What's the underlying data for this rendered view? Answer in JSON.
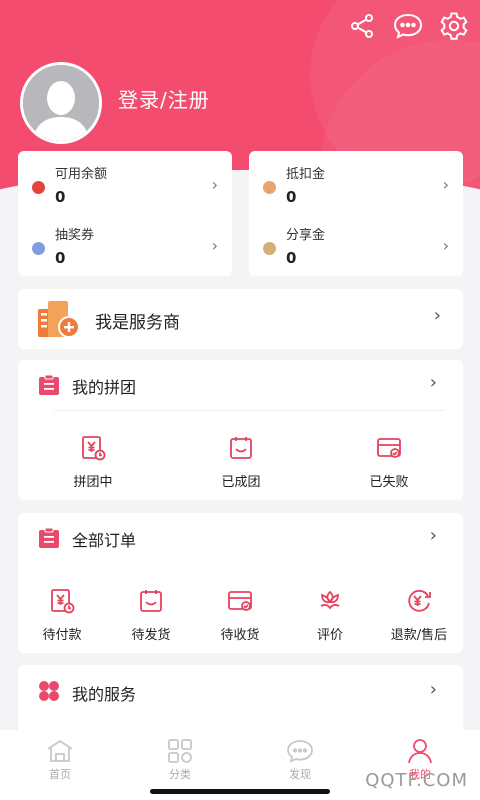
{
  "header": {
    "login_text": "登录/注册",
    "share_icon": "share-icon",
    "message_icon": "chat-bubble-icon",
    "settings_icon": "gear-icon",
    "brand_color": "#f34c6f"
  },
  "wallet": {
    "left": [
      {
        "label": "可用余额",
        "value": "0",
        "dot_color": "#e5443e"
      },
      {
        "label": "抽奖券",
        "value": "0",
        "dot_color": "#7f9de0"
      }
    ],
    "right": [
      {
        "label": "抵扣金",
        "value": "0",
        "dot_color": "#e8a46c"
      },
      {
        "label": "分享金",
        "value": "0",
        "dot_color": "#d3b07a"
      }
    ]
  },
  "provider": {
    "label": "我是服务商"
  },
  "group": {
    "title": "我的拼团",
    "items": [
      {
        "label": "拼团中",
        "icon": "yen-clock-icon"
      },
      {
        "label": "已成团",
        "icon": "clipboard-smile-icon"
      },
      {
        "label": "已失败",
        "icon": "box-check-icon"
      }
    ]
  },
  "orders": {
    "title": "全部订单",
    "items": [
      {
        "label": "待付款",
        "icon": "yen-clock-icon"
      },
      {
        "label": "待发货",
        "icon": "clipboard-smile-icon"
      },
      {
        "label": "待收货",
        "icon": "box-check-icon"
      },
      {
        "label": "评价",
        "icon": "flower-icon"
      },
      {
        "label": "退款/售后",
        "icon": "refund-yen-icon"
      }
    ]
  },
  "services": {
    "title": "我的服务"
  },
  "nav": [
    {
      "label": "首页",
      "icon": "home-icon",
      "active": false
    },
    {
      "label": "分类",
      "icon": "category-icon",
      "active": false
    },
    {
      "label": "发现",
      "icon": "discover-chat-icon",
      "active": false
    },
    {
      "label": "我的",
      "icon": "user-icon",
      "active": true
    }
  ],
  "watermark": "QQTF.COM"
}
